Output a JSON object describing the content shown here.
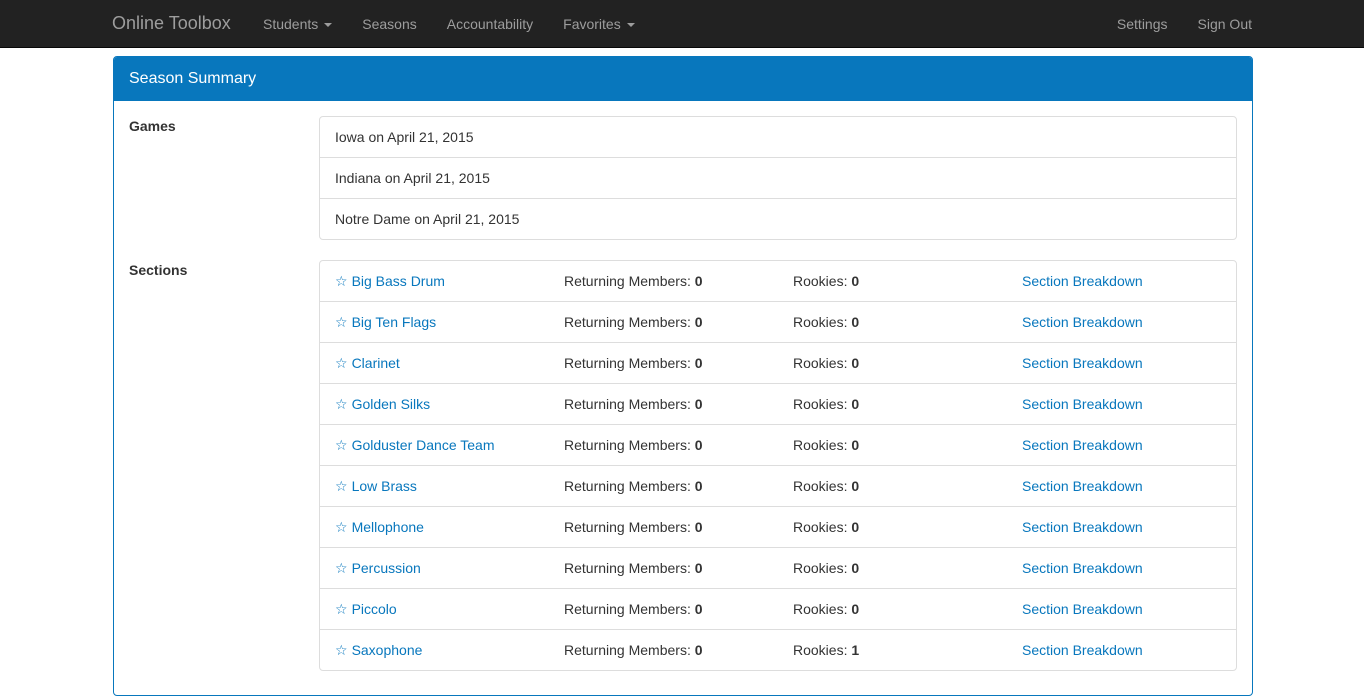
{
  "navbar": {
    "brand": "Online Toolbox",
    "left_items": [
      {
        "label": "Students",
        "dropdown": true
      },
      {
        "label": "Seasons",
        "dropdown": false
      },
      {
        "label": "Accountability",
        "dropdown": false
      },
      {
        "label": "Favorites",
        "dropdown": true
      }
    ],
    "right_items": [
      {
        "label": "Settings"
      },
      {
        "label": "Sign Out"
      }
    ]
  },
  "panel": {
    "title": "Season Summary",
    "accent_color": "#0877bd"
  },
  "games": {
    "label": "Games",
    "items": [
      "Iowa on April 21, 2015",
      "Indiana on April 21, 2015",
      "Notre Dame on April 21, 2015"
    ]
  },
  "sections": {
    "label": "Sections",
    "returning_label": "Returning Members:",
    "rookies_label": "Rookies:",
    "link_label": "Section Breakdown",
    "icon": "star-outline-icon",
    "rows": [
      {
        "name": "Big Bass Drum",
        "returning": "0",
        "rookies": "0"
      },
      {
        "name": "Big Ten Flags",
        "returning": "0",
        "rookies": "0"
      },
      {
        "name": "Clarinet",
        "returning": "0",
        "rookies": "0"
      },
      {
        "name": "Golden Silks",
        "returning": "0",
        "rookies": "0"
      },
      {
        "name": "Golduster Dance Team",
        "returning": "0",
        "rookies": "0"
      },
      {
        "name": "Low Brass",
        "returning": "0",
        "rookies": "0"
      },
      {
        "name": "Mellophone",
        "returning": "0",
        "rookies": "0"
      },
      {
        "name": "Percussion",
        "returning": "0",
        "rookies": "0"
      },
      {
        "name": "Piccolo",
        "returning": "0",
        "rookies": "0"
      },
      {
        "name": "Saxophone",
        "returning": "0",
        "rookies": "1"
      }
    ]
  }
}
